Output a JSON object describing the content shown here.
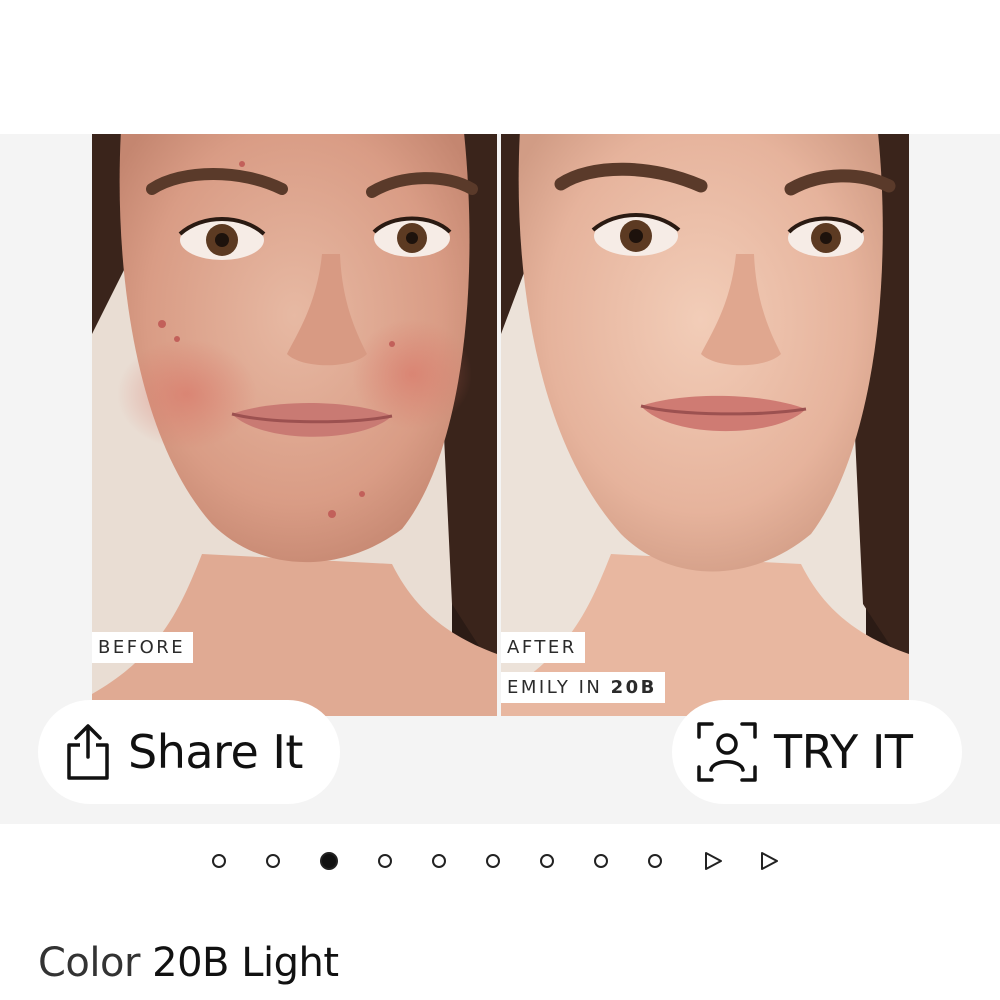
{
  "gallery": {
    "before_label": "BEFORE",
    "after_label": "AFTER",
    "model_prefix": "EMILY IN",
    "model_shade": "20B"
  },
  "actions": {
    "share_label": "Share It",
    "share_icon": "share-icon",
    "try_label": "TRY IT",
    "try_icon": "face-scan-icon"
  },
  "pager": {
    "total_dots": 9,
    "active_index": 2,
    "controls": [
      "play-icon",
      "play-icon"
    ]
  },
  "color": {
    "prefix": "Color",
    "value": "20B Light"
  },
  "colors": {
    "background": "#ffffff",
    "gallery_bg": "#f4f4f4",
    "text": "#111111"
  }
}
